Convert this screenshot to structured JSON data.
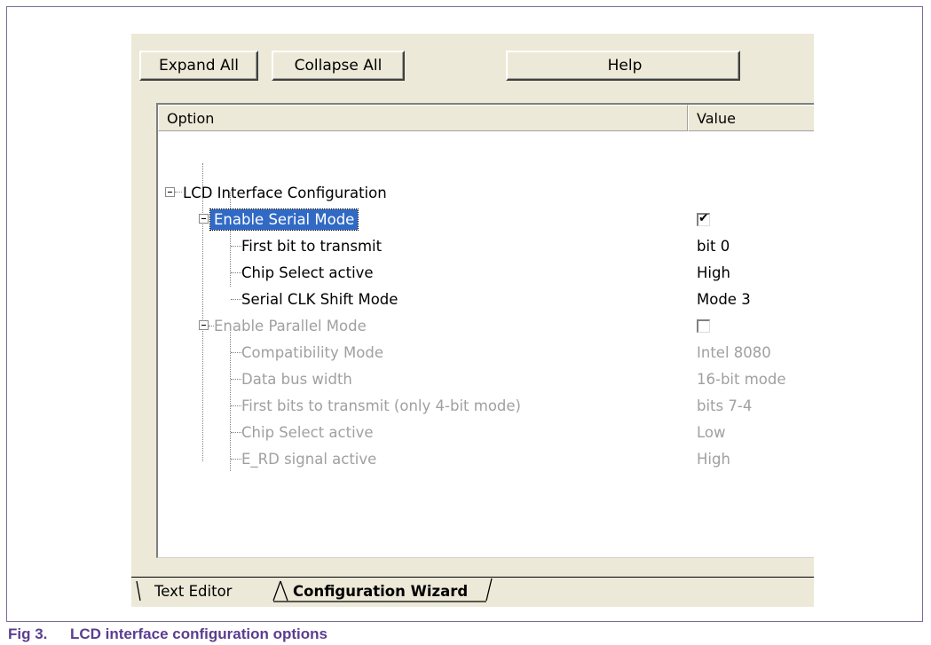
{
  "toolbar": {
    "expand_all": "Expand All",
    "collapse_all": "Collapse All",
    "help": "Help"
  },
  "columns": {
    "option": "Option",
    "value": "Value"
  },
  "tree": {
    "root": "LCD Interface Configuration",
    "serial": {
      "label": "Enable Serial Mode",
      "checked": true,
      "items": [
        {
          "label": "First bit to transmit",
          "value": "bit 0"
        },
        {
          "label": "Chip Select active",
          "value": "High"
        },
        {
          "label": "Serial CLK Shift Mode",
          "value": "Mode 3"
        }
      ]
    },
    "parallel": {
      "label": "Enable Parallel Mode",
      "checked": false,
      "items": [
        {
          "label": "Compatibility Mode",
          "value": "Intel 8080"
        },
        {
          "label": "Data bus width",
          "value": "16-bit mode"
        },
        {
          "label": "First bits to transmit (only 4-bit mode)",
          "value": "bits 7-4"
        },
        {
          "label": "Chip Select active",
          "value": "Low"
        },
        {
          "label": "E_RD signal active",
          "value": "High"
        }
      ]
    }
  },
  "tabs": {
    "text_editor": "Text Editor",
    "configuration_wizard": "Configuration Wizard"
  },
  "caption": {
    "number": "Fig 3.",
    "text": "LCD interface configuration options"
  },
  "colors": {
    "selection": "#316ac5",
    "disabled_text": "#a0a0a0",
    "caption": "#5b3d8f",
    "window_bg": "#ece9d8"
  }
}
